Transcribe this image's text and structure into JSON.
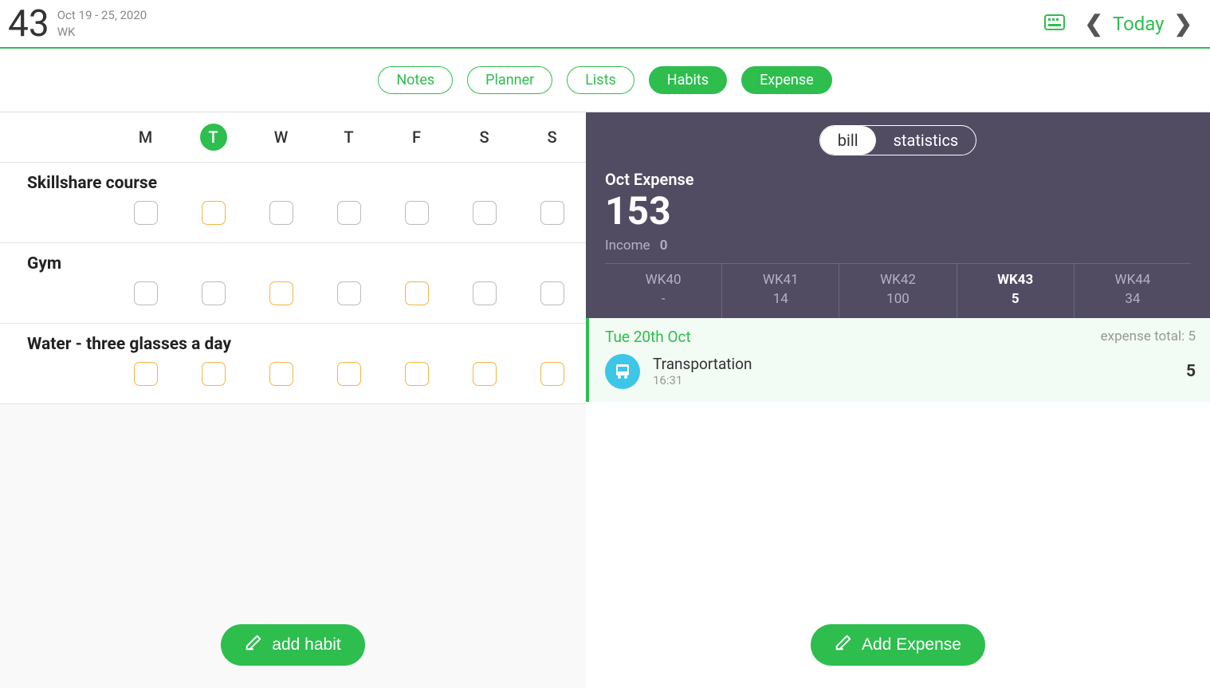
{
  "header": {
    "week_number": "43",
    "date_range": "Oct 19 - 25, 2020",
    "wk_label": "WK",
    "today": "Today"
  },
  "tabs": {
    "notes": "Notes",
    "planner": "Planner",
    "lists": "Lists",
    "habits": "Habits",
    "expense": "Expense"
  },
  "days": [
    "M",
    "T",
    "W",
    "T",
    "F",
    "S",
    "S"
  ],
  "active_day_index": 1,
  "habits": [
    {
      "title": "Skillshare course",
      "checks": [
        "grey",
        "orange",
        "grey",
        "grey",
        "grey",
        "grey",
        "grey"
      ]
    },
    {
      "title": "Gym",
      "checks": [
        "grey",
        "grey",
        "orange",
        "grey",
        "orange",
        "grey",
        "grey"
      ]
    },
    {
      "title": "Water - three glasses a day",
      "checks": [
        "orange",
        "orange",
        "orange",
        "orange",
        "orange",
        "orange",
        "orange"
      ]
    }
  ],
  "add_habit_label": "add habit",
  "expense_panel": {
    "toggle": {
      "bill": "bill",
      "stats": "statistics"
    },
    "month_label": "Oct Expense",
    "month_total": "153",
    "income_label": "Income",
    "income_value": "0",
    "weeks": [
      {
        "label": "WK40",
        "value": "-"
      },
      {
        "label": "WK41",
        "value": "14"
      },
      {
        "label": "WK42",
        "value": "100"
      },
      {
        "label": "WK43",
        "value": "5",
        "current": true
      },
      {
        "label": "WK44",
        "value": "34"
      }
    ],
    "day": {
      "date": "Tue 20th Oct",
      "total_label": "expense total: 5",
      "entries": [
        {
          "category": "Transportation",
          "time": "16:31",
          "amount": "5"
        }
      ]
    },
    "add_expense_label": "Add Expense"
  }
}
